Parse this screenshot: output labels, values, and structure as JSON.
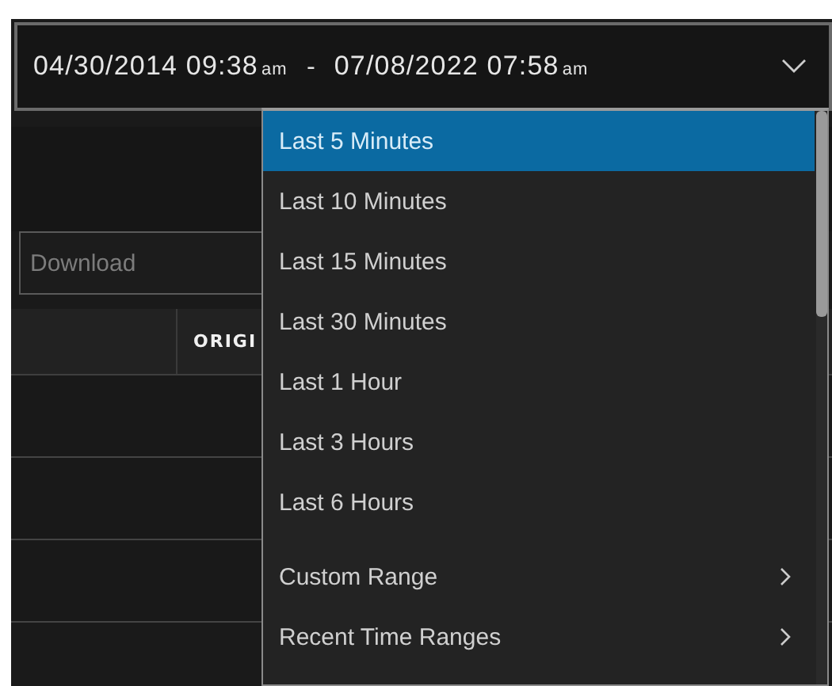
{
  "date_range": {
    "start": {
      "value": "04/30/2014 09:38",
      "meridiem": "am"
    },
    "separator": "-",
    "end": {
      "value": "07/08/2022 07:58",
      "meridiem": "am"
    }
  },
  "download_field": {
    "placeholder": "Download"
  },
  "table": {
    "columns": [
      {
        "label": "ORIGI"
      }
    ]
  },
  "menu": [
    {
      "label": "Last 5 Minutes",
      "kind": "option",
      "selected": true
    },
    {
      "label": "Last 10 Minutes",
      "kind": "option",
      "selected": false
    },
    {
      "label": "Last 15 Minutes",
      "kind": "option",
      "selected": false
    },
    {
      "label": "Last 30 Minutes",
      "kind": "option",
      "selected": false
    },
    {
      "label": "Last 1 Hour",
      "kind": "option",
      "selected": false
    },
    {
      "label": "Last 3 Hours",
      "kind": "option",
      "selected": false
    },
    {
      "label": "Last 6 Hours",
      "kind": "option",
      "selected": false
    },
    {
      "label": "Custom Range",
      "kind": "submenu",
      "selected": false
    },
    {
      "label": "Recent Time Ranges",
      "kind": "submenu",
      "selected": false
    }
  ]
}
